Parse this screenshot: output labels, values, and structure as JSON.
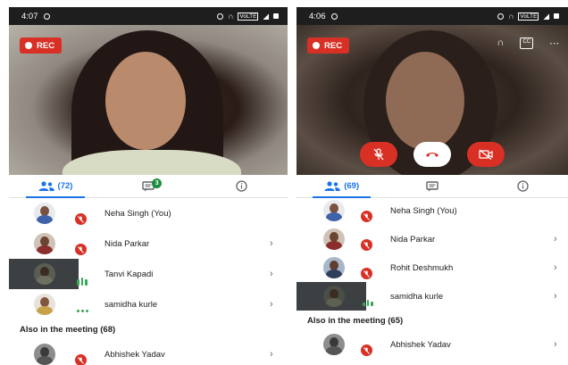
{
  "left": {
    "status": {
      "time": "4:07",
      "net": "VoLTE"
    },
    "rec_label": "REC",
    "tabs": {
      "people_count": "(72)",
      "chat_badge": "3"
    },
    "participants": [
      {
        "name": "Neha Singh (You)",
        "state": "muted"
      },
      {
        "name": "Nida Parkar",
        "state": "muted"
      },
      {
        "name": "Tanvi Kapadi",
        "state": "speaking"
      },
      {
        "name": "samidha kurle",
        "state": "dots"
      }
    ],
    "also_label": "Also in the meeting (68)",
    "also": [
      {
        "name": "Abhishek Yadav",
        "state": "muted"
      }
    ]
  },
  "right": {
    "status": {
      "time": "4:06",
      "net": "VoLTE"
    },
    "rec_label": "REC",
    "tabs": {
      "people_count": "(69)"
    },
    "participants": [
      {
        "name": "Neha Singh (You)",
        "state": "muted"
      },
      {
        "name": "Nida Parkar",
        "state": "muted"
      },
      {
        "name": "Rohit Deshmukh",
        "state": "muted"
      },
      {
        "name": "samidha kurle",
        "state": "speaking"
      }
    ],
    "also_label": "Also in the meeting (65)",
    "also": [
      {
        "name": "Abhishek Yadav",
        "state": "muted"
      }
    ]
  },
  "colors": {
    "accent": "#1a73e8",
    "danger": "#d93025",
    "speaking": "#34a853"
  }
}
